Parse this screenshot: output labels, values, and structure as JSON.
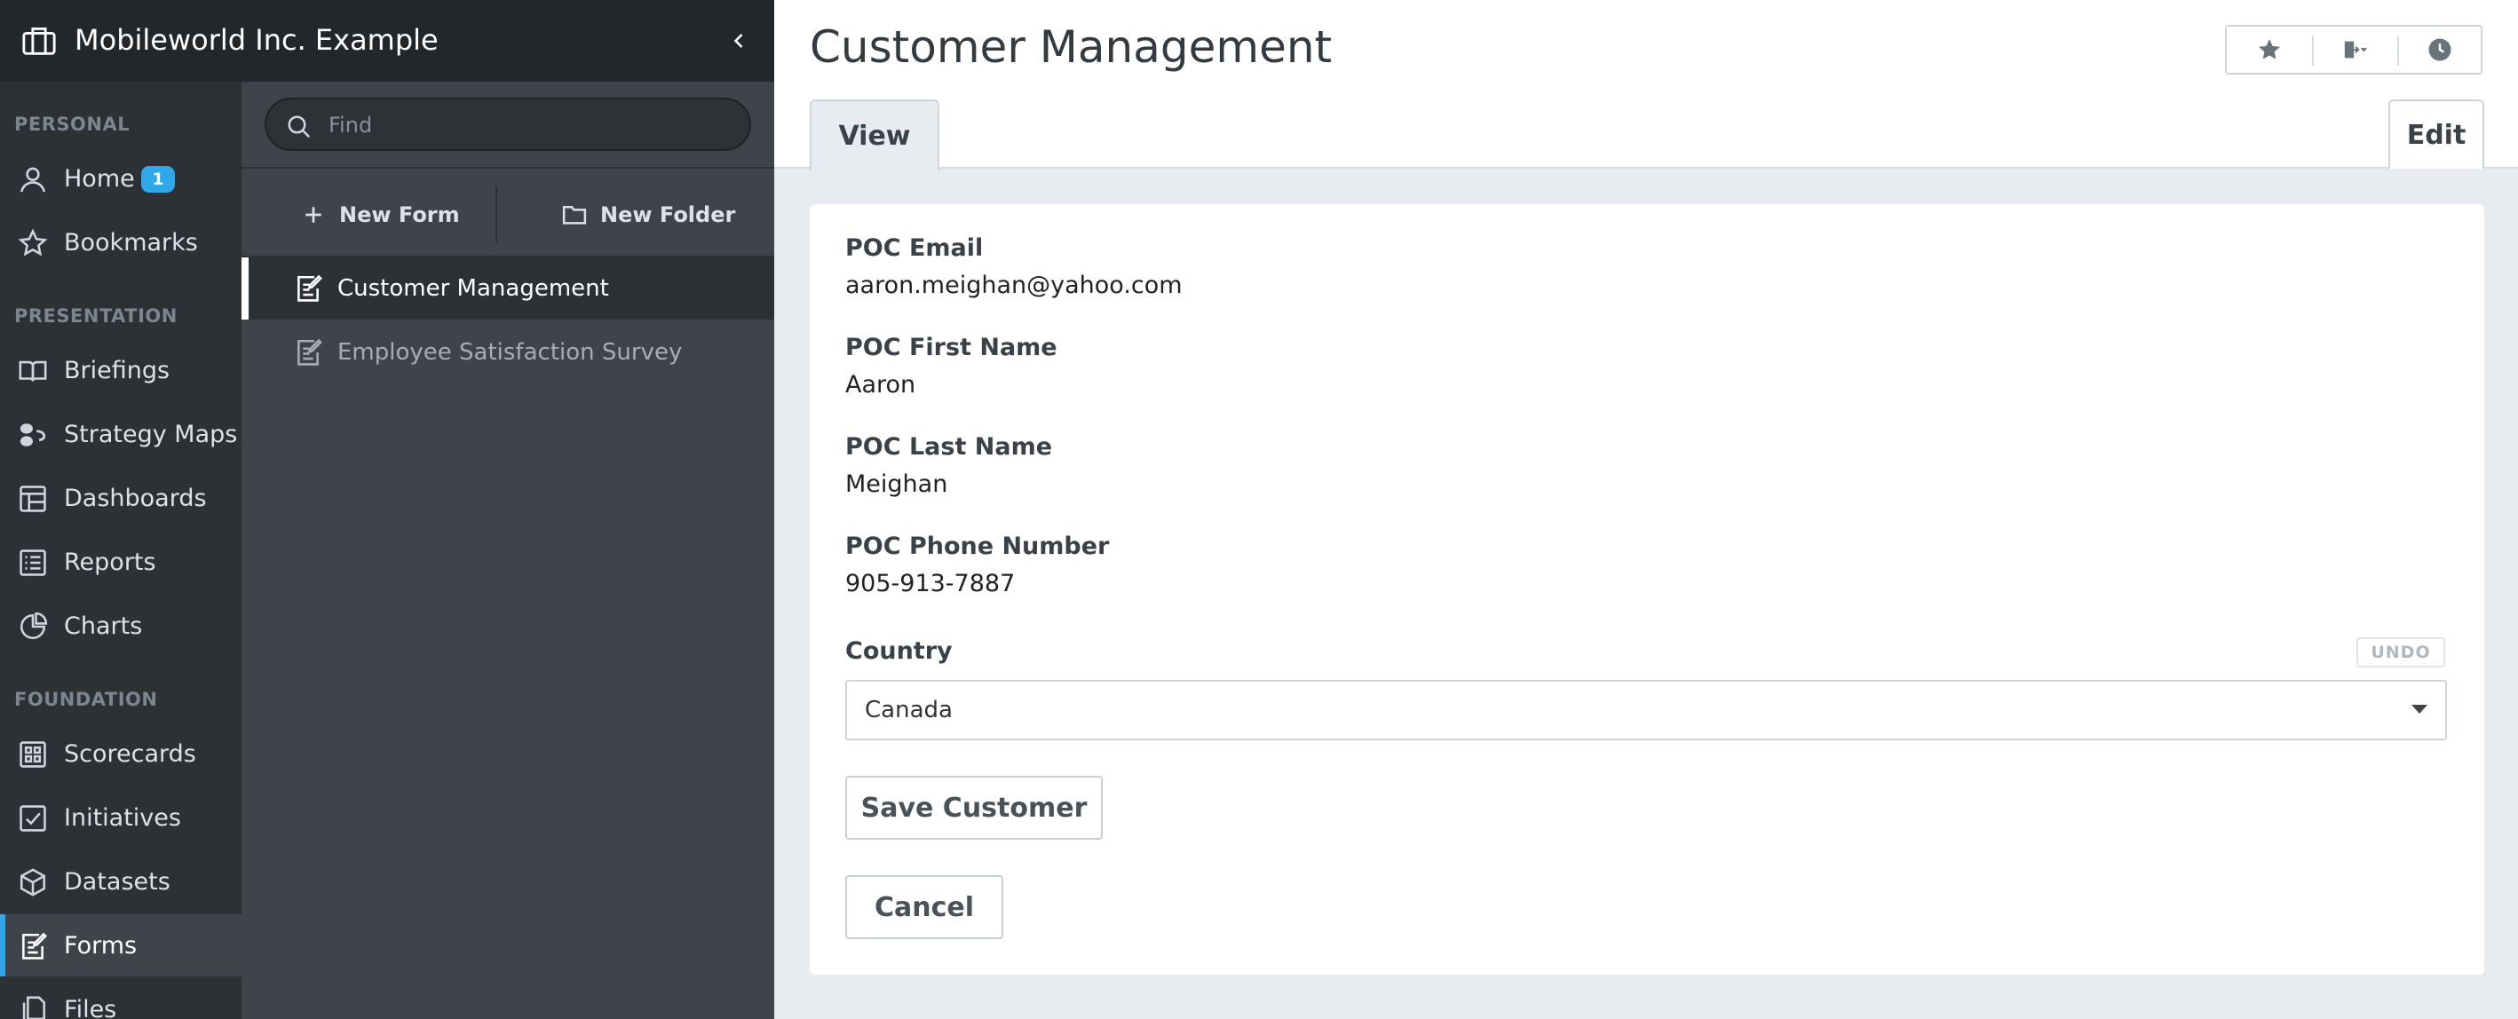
{
  "org": {
    "name": "Mobileworld Inc. Example"
  },
  "nav": {
    "sections": {
      "personal": "PERSONAL",
      "presentation": "PRESENTATION",
      "foundation": "FOUNDATION"
    },
    "items": [
      {
        "label": "Home",
        "icon": "user-icon",
        "badge": "1"
      },
      {
        "label": "Bookmarks",
        "icon": "star-icon"
      },
      {
        "label": "Briefings",
        "icon": "book-icon"
      },
      {
        "label": "Strategy Maps",
        "icon": "strategy-map-icon"
      },
      {
        "label": "Dashboards",
        "icon": "dashboard-icon"
      },
      {
        "label": "Reports",
        "icon": "list-icon"
      },
      {
        "label": "Charts",
        "icon": "pie-chart-icon"
      },
      {
        "label": "Scorecards",
        "icon": "scorecard-icon"
      },
      {
        "label": "Initiatives",
        "icon": "checkbox-icon"
      },
      {
        "label": "Datasets",
        "icon": "cube-icon"
      },
      {
        "label": "Forms",
        "icon": "form-icon",
        "active": true
      },
      {
        "label": "Files",
        "icon": "file-icon"
      }
    ],
    "accent_color": "#2fa7e8"
  },
  "panel": {
    "search_placeholder": "Find",
    "new_form_label": "New Form",
    "new_folder_label": "New Folder",
    "forms": [
      {
        "label": "Customer Management",
        "active": true
      },
      {
        "label": "Employee Satisfaction Survey",
        "active": false
      }
    ]
  },
  "main": {
    "title": "Customer Management",
    "tabs": {
      "view": "View",
      "edit": "Edit"
    },
    "fields": [
      {
        "label": "POC Email",
        "value": "aaron.meighan@yahoo.com"
      },
      {
        "label": "POC First Name",
        "value": "Aaron"
      },
      {
        "label": "POC Last Name",
        "value": "Meighan"
      },
      {
        "label": "POC Phone Number",
        "value": "905-913-7887"
      }
    ],
    "country": {
      "label": "Country",
      "value": "Canada",
      "undo_label": "UNDO"
    },
    "save_label": "Save Customer",
    "cancel_label": "Cancel"
  }
}
